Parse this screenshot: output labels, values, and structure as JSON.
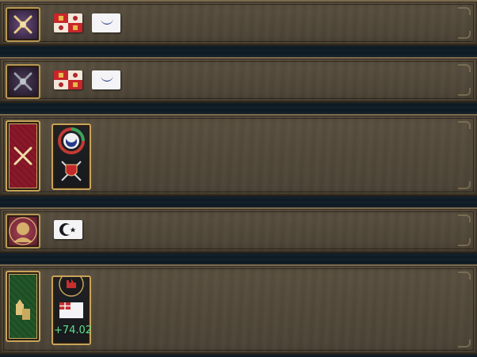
{
  "rows": [
    {
      "type_icon": "crossed-swords-icon",
      "flags": [
        "castile-flag",
        "crescent-flag"
      ]
    },
    {
      "type_icon": "crossed-swords-icon",
      "flags": [
        "castile-flag",
        "crescent-flag"
      ]
    },
    {
      "type_icon": "crossed-swords-icon",
      "card_icons": [
        "war-goal-icon",
        "shield-swords-icon"
      ]
    },
    {
      "type_icon": "ruler-portrait-icon",
      "flags": [
        "crescent-star-flag"
      ]
    },
    {
      "type_icon": "trade-ships-icon",
      "card_icons": [
        "fortress-icon",
        "english-flag"
      ],
      "card_value": "+74.02"
    }
  ],
  "colors": {
    "panel": "#514839",
    "gold_border": "#c8a45a",
    "value_green": "#5ee08a"
  }
}
